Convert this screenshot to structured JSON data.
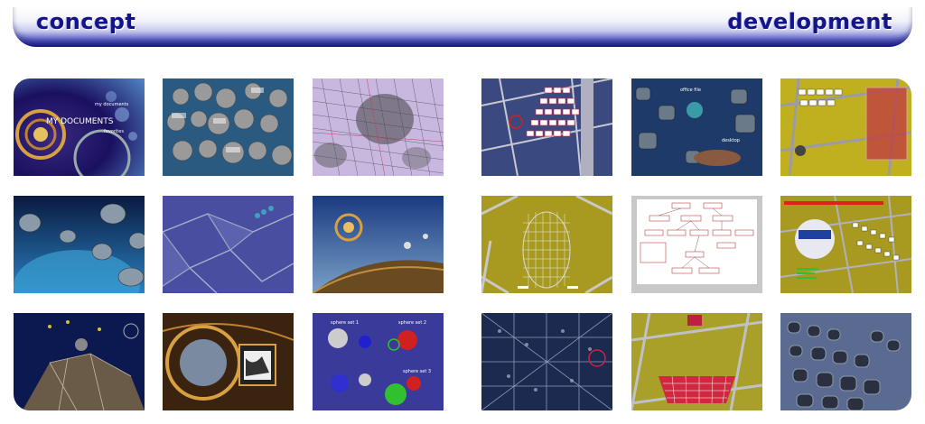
{
  "header": {
    "left_title": "concept",
    "right_title": "development",
    "accent_color": "#14148a"
  },
  "concept": {
    "thumb1": {
      "line1": "MY DOCUMENTS",
      "line2": "my documents",
      "line3": "favorites"
    },
    "thumb9": {
      "label_a": "sphere set 1",
      "label_b": "sphere set 2",
      "label_c": "sphere set 3"
    }
  },
  "development": {
    "thumb5": {
      "label_a": "office file",
      "label_b": "desktop"
    }
  }
}
